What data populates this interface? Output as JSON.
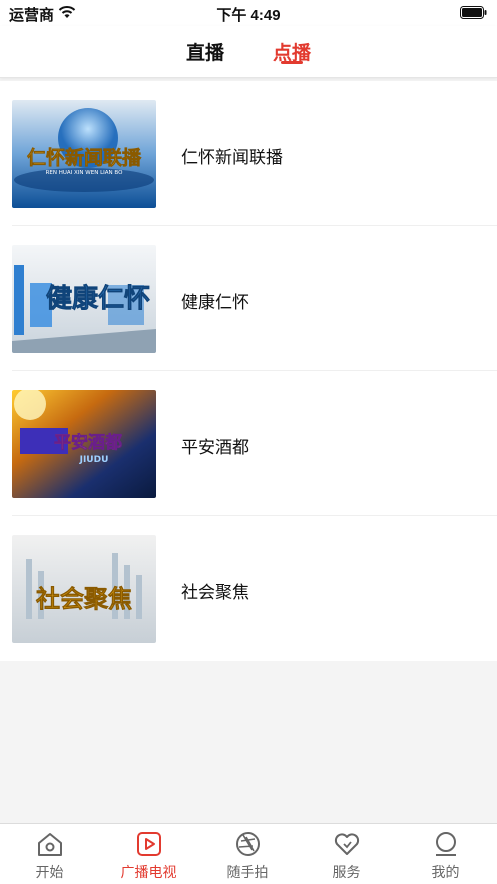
{
  "status_bar": {
    "carrier": "运营商",
    "time": "下午 4:49"
  },
  "top_tabs": [
    {
      "label": "直播",
      "active": false
    },
    {
      "label": "点播",
      "active": true
    }
  ],
  "programs": [
    {
      "title": "仁怀新闻联播",
      "thumb_title": "仁怀新闻联播",
      "thumb_sub": "REN HUAI XIN WEN LIAN BO"
    },
    {
      "title": "健康仁怀",
      "thumb_title": "健康仁怀"
    },
    {
      "title": "平安酒都",
      "thumb_title": "平安酒都",
      "thumb_sub": "JIUDU"
    },
    {
      "title": "社会聚焦",
      "thumb_title": "社会聚焦"
    }
  ],
  "bottom_nav": [
    {
      "label": "开始",
      "icon": "home-icon",
      "active": false
    },
    {
      "label": "广播电视",
      "icon": "play-icon",
      "active": true
    },
    {
      "label": "随手拍",
      "icon": "aperture-icon",
      "active": false
    },
    {
      "label": "服务",
      "icon": "heart-icon",
      "active": false
    },
    {
      "label": "我的",
      "icon": "user-icon",
      "active": false
    }
  ],
  "colors": {
    "accent": "#e23a2f",
    "inactive": "#666666"
  }
}
